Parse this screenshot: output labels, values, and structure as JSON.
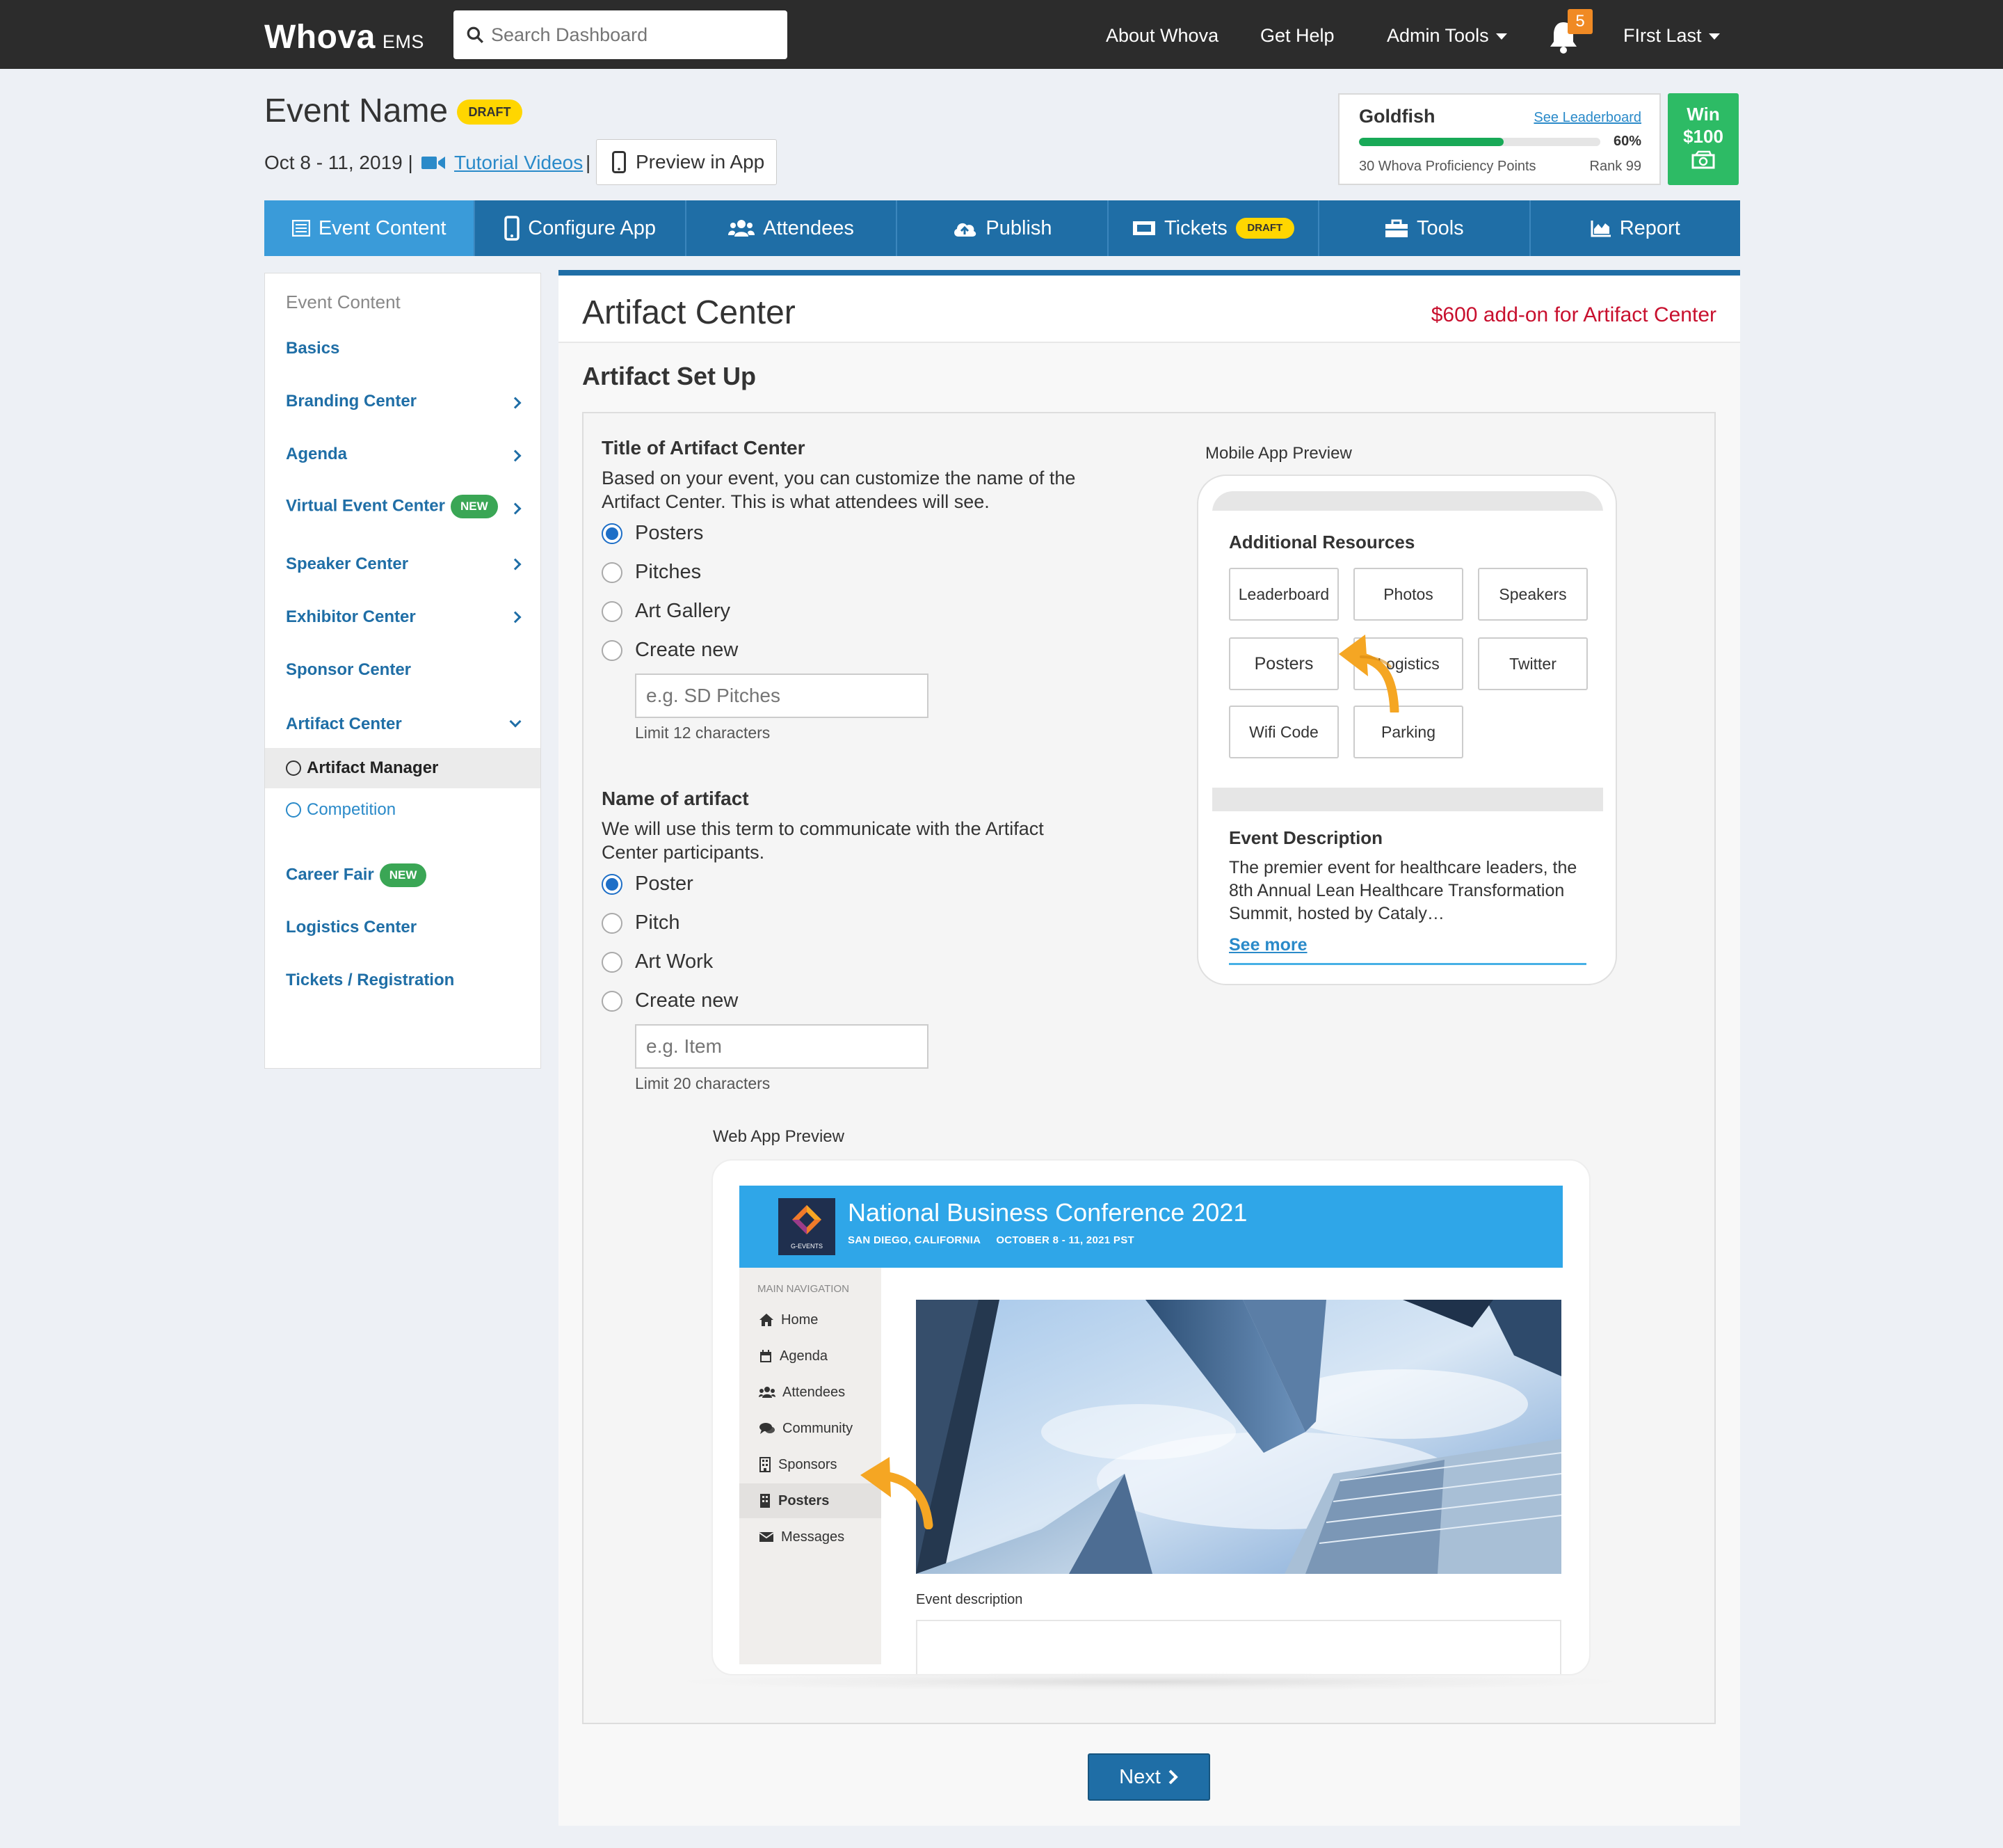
{
  "topbar": {
    "brand": "Whova",
    "brand_suffix": "EMS",
    "search_placeholder": "Search Dashboard",
    "about": "About Whova",
    "help": "Get Help",
    "admin_tools": "Admin Tools",
    "notification_count": "5",
    "user_name": "FIrst Last"
  },
  "event": {
    "name": "Event Name",
    "status_badge": "DRAFT",
    "dates": "Oct 8 - 11, 2019 |",
    "tutorial_videos": "Tutorial Videos",
    "separator": "|",
    "preview_in_app": "Preview in App"
  },
  "leaderboard": {
    "tier": "Goldfish",
    "see_leaderboard": "See Leaderboard",
    "progress_percent": 60,
    "progress_label": "60%",
    "points_label": "30 Whova Proficiency Points",
    "rank_label": "Rank 99",
    "win_line1": "Win",
    "win_line2": "$100"
  },
  "tabs": [
    {
      "label": "Event Content",
      "icon": "list-icon",
      "active": true
    },
    {
      "label": "Configure App",
      "icon": "phone-icon"
    },
    {
      "label": "Attendees",
      "icon": "users-icon"
    },
    {
      "label": "Publish",
      "icon": "cloud-upload-icon"
    },
    {
      "label": "Tickets",
      "icon": "ticket-icon",
      "badge": "DRAFT"
    },
    {
      "label": "Tools",
      "icon": "toolbox-icon"
    },
    {
      "label": "Report",
      "icon": "area-chart-icon"
    }
  ],
  "sidebar": {
    "heading": "Event Content",
    "items": [
      {
        "label": "Basics"
      },
      {
        "label": "Branding Center"
      },
      {
        "label": "Agenda"
      },
      {
        "label": "Virtual Event Center",
        "badge": "NEW"
      },
      {
        "label": "Speaker Center"
      },
      {
        "label": "Exhibitor Center"
      },
      {
        "label": "Sponsor Center"
      },
      {
        "label": "Artifact Center"
      },
      {
        "label": "Career Fair",
        "badge": "NEW"
      },
      {
        "label": "Logistics Center"
      },
      {
        "label": "Tickets / Registration"
      }
    ],
    "subitems": [
      {
        "label": "Artifact Manager",
        "active": true
      },
      {
        "label": "Competition",
        "active": false
      }
    ]
  },
  "main": {
    "title": "Artifact Center",
    "addon": "$600 add-on for Artifact Center",
    "section_title": "Artifact Set Up",
    "title_field": {
      "label": "Title of Artifact Center",
      "description": "Based on your event, you can customize the name of the Artifact Center. This is what attendees will see.",
      "options": [
        "Posters",
        "Pitches",
        "Art Gallery",
        "Create new"
      ],
      "selected": "Posters",
      "placeholder": "e.g. SD Pitches",
      "limit": "Limit 12 characters"
    },
    "name_field": {
      "label": "Name of artifact",
      "description": "We will use this term to communicate with the Artifact Center participants.",
      "options": [
        "Poster",
        "Pitch",
        "Art Work",
        "Create new"
      ],
      "selected": "Poster",
      "placeholder": "e.g. Item",
      "limit": "Limit 20 characters"
    },
    "next_button": "Next"
  },
  "mobile_preview": {
    "label": "Mobile App Preview",
    "resources_title": "Additional Resources",
    "resources": [
      "Leaderboard",
      "Photos",
      "Speakers",
      "Posters",
      "Logistics",
      "Twitter",
      "Wifi Code",
      "Parking"
    ],
    "description_title": "Event Description",
    "description": "The premier event for healthcare leaders, the 8th Annual Lean Healthcare Transformation Summit, hosted by Cataly…",
    "see_more": "See more",
    "accent": "#f5a623"
  },
  "web_preview": {
    "label": "Web App Preview",
    "conference_title": "National Business Conference 2021",
    "location": "SAN DIEGO, CALIFORNIA",
    "dates": "OCTOBER 8 - 11, 2021 PST",
    "logo_text": "G-EVENTS",
    "nav_heading": "MAIN NAVIGATION",
    "nav": [
      {
        "label": "Home",
        "icon": "home-icon"
      },
      {
        "label": "Agenda",
        "icon": "calendar-icon"
      },
      {
        "label": "Attendees",
        "icon": "users-icon"
      },
      {
        "label": "Community",
        "icon": "comments-icon"
      },
      {
        "label": "Sponsors",
        "icon": "building-icon"
      },
      {
        "label": "Posters",
        "icon": "building-icon",
        "active": true
      },
      {
        "label": "Messages",
        "icon": "envelope-icon"
      }
    ],
    "event_description_label": "Event description"
  }
}
